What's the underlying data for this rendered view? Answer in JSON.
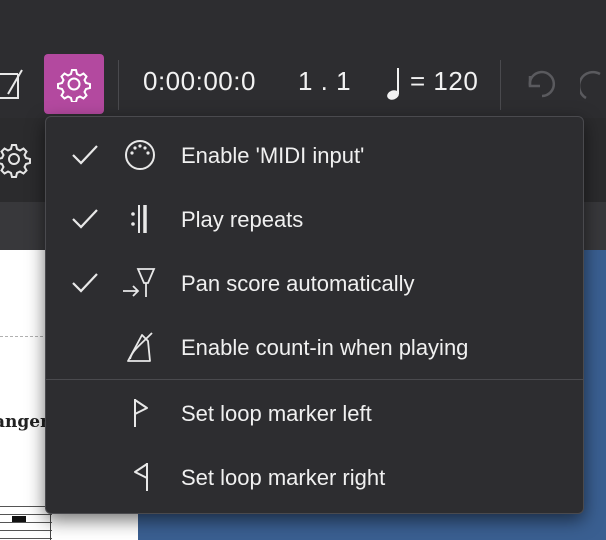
{
  "colors": {
    "accent": "#b3499f",
    "toolbar": "#2d2d30",
    "menu": "#2d2d30",
    "score_bg": "#3a5f91"
  },
  "toolbar": {
    "time": "0:00:00:0",
    "position": "1 . 1",
    "tempo_value": "= 120",
    "icons": [
      "edit-icon",
      "playback-settings-gear-icon",
      "quarter-note-icon",
      "undo-icon",
      "redo-icon"
    ]
  },
  "subbar": {
    "icons": [
      "gear-icon"
    ]
  },
  "score": {
    "fragment_text": "anger"
  },
  "menu": {
    "items": [
      {
        "label": "Enable 'MIDI input'",
        "checked": true,
        "icon": "midi-port-icon"
      },
      {
        "label": "Play repeats",
        "checked": true,
        "icon": "repeat-barline-icon"
      },
      {
        "label": "Pan score automatically",
        "checked": true,
        "icon": "pan-score-icon"
      },
      {
        "label": "Enable count-in when playing",
        "checked": false,
        "icon": "metronome-icon"
      },
      {
        "label": "Set loop marker left",
        "checked": false,
        "icon": "loop-marker-left-icon"
      },
      {
        "label": "Set loop marker right",
        "checked": false,
        "icon": "loop-marker-right-icon"
      }
    ]
  }
}
